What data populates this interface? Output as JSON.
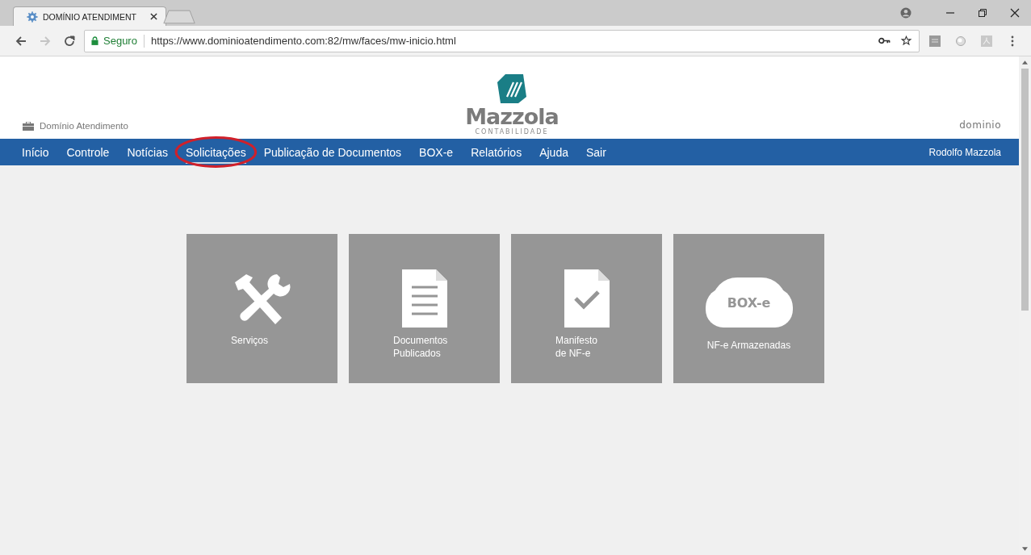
{
  "browser": {
    "tab": {
      "title": "DOMÍNIO ATENDIMENT",
      "selected": true
    },
    "security_label": "Seguro",
    "url": "https://www.dominioatendimento.com:82/mw/faces/mw-inicio.html",
    "forward_disabled": true
  },
  "header": {
    "app_name": "Domínio Atendimento",
    "logo_name": "Mazzola",
    "logo_tagline": "CONTABILIDADE",
    "brand": "dominio"
  },
  "nav": {
    "items": [
      {
        "label": "Início",
        "selected": false,
        "circled": false
      },
      {
        "label": "Controle",
        "selected": false,
        "circled": false
      },
      {
        "label": "Notícias",
        "selected": false,
        "circled": false
      },
      {
        "label": "Solicitações",
        "selected": true,
        "circled": true
      },
      {
        "label": "Publicação de Documentos",
        "selected": false,
        "circled": false
      },
      {
        "label": "BOX-e",
        "selected": false,
        "circled": false
      },
      {
        "label": "Relatórios",
        "selected": false,
        "circled": false
      },
      {
        "label": "Ajuda",
        "selected": false,
        "circled": false
      },
      {
        "label": "Sair",
        "selected": false,
        "circled": false
      }
    ],
    "user": "Rodolfo Mazzola"
  },
  "tiles": [
    {
      "kind": "tools",
      "label": [
        "Serviços"
      ]
    },
    {
      "kind": "document",
      "label": [
        "Documentos",
        "Publicados"
      ]
    },
    {
      "kind": "check",
      "label": [
        "Manifesto",
        "de NF-e"
      ]
    },
    {
      "kind": "cloud",
      "icon_text": "BOX-e",
      "label": [
        "NF-e Armazenadas"
      ]
    }
  ]
}
